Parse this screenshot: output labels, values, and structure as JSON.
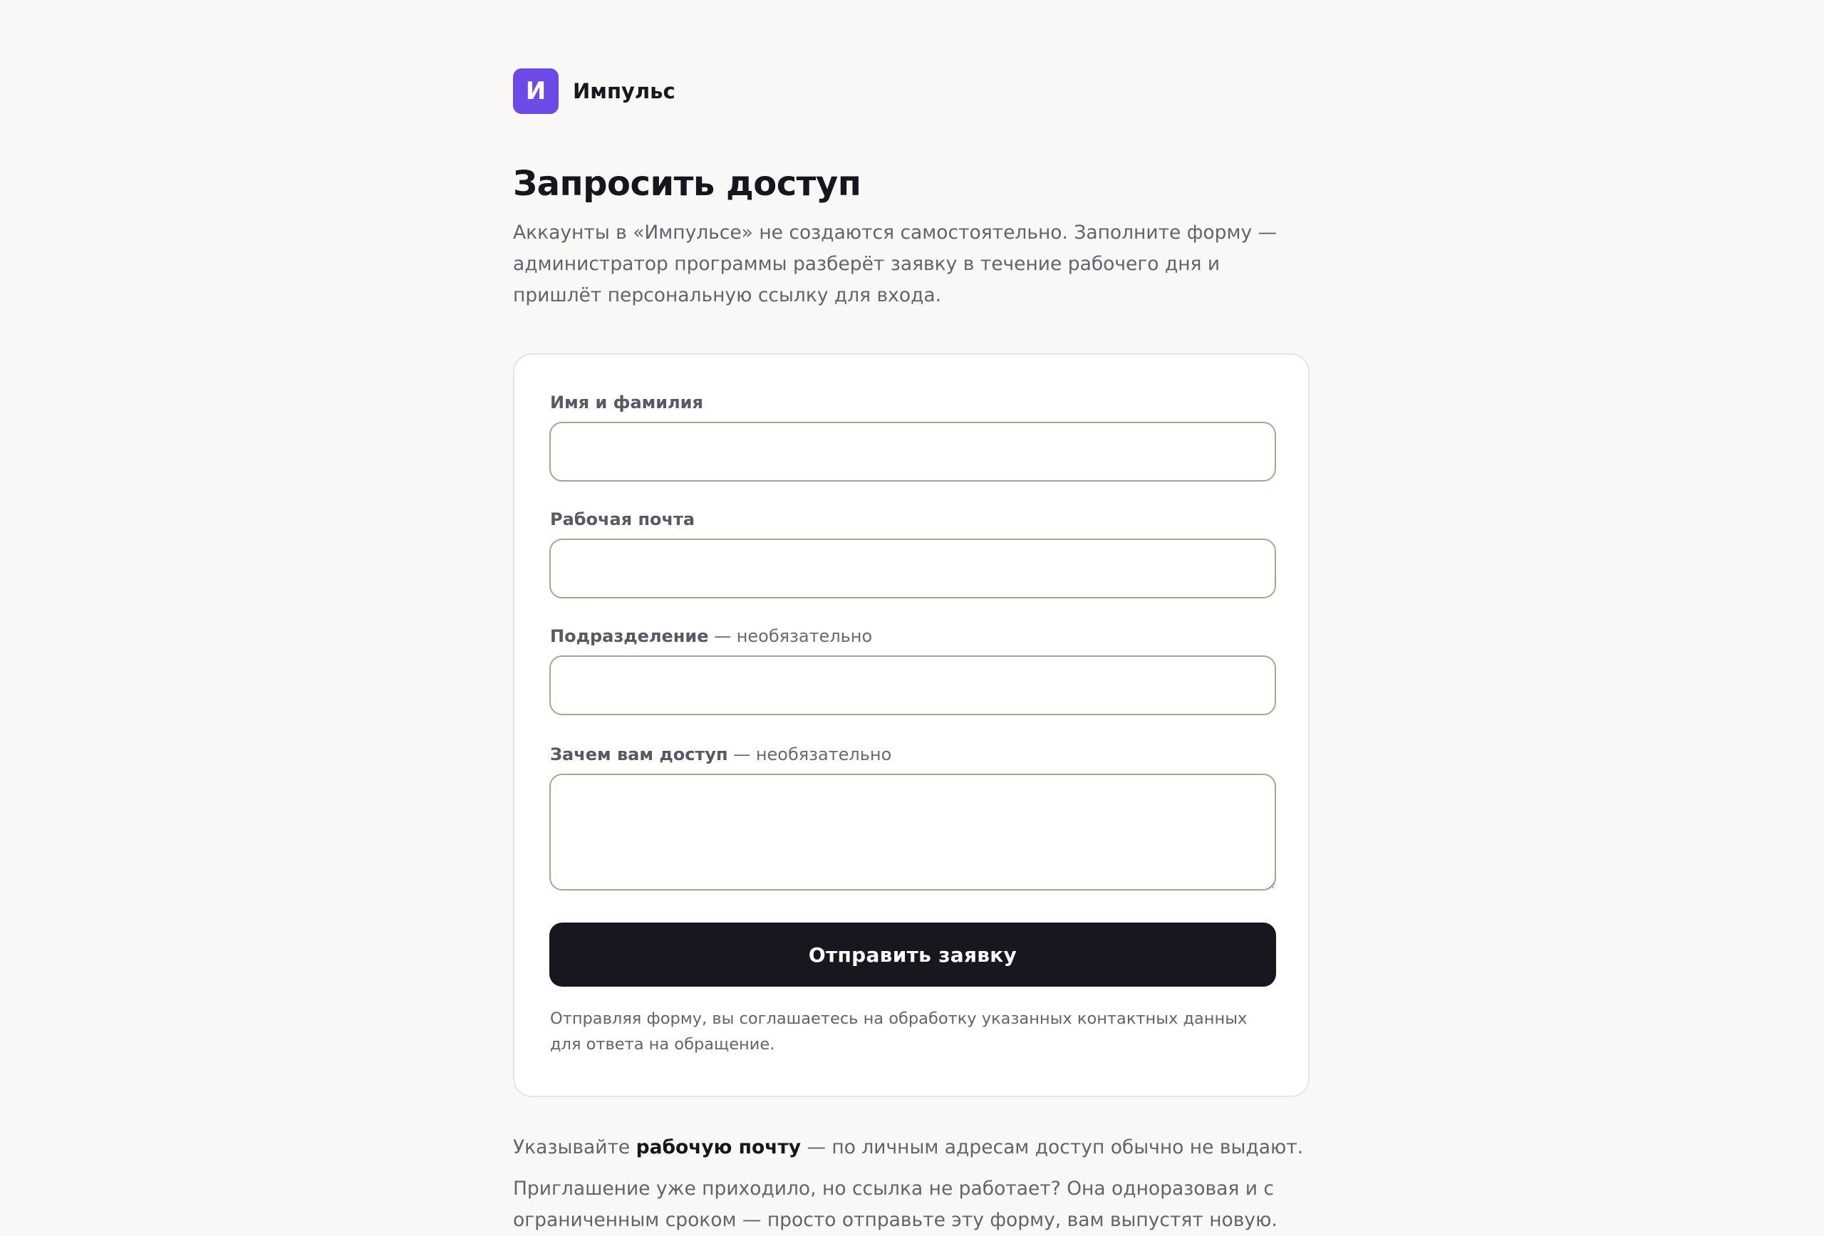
{
  "brand": {
    "mark": "И",
    "name": "Импульс"
  },
  "page": {
    "title": "Запросить доступ",
    "intro": "Аккаунты в «Импульсе» не создаются самостоятельно. Заполните форму — администратор программы разберёт заявку в течение рабочего дня и пришлёт персональную ссылку для входа."
  },
  "form": {
    "fields": [
      {
        "label": "Имя и фамилия",
        "optional": "",
        "value": ""
      },
      {
        "label": "Рабочая почта",
        "optional": "",
        "value": ""
      },
      {
        "label": "Подразделение",
        "optional": " — необязательно",
        "value": ""
      },
      {
        "label": "Зачем вам доступ",
        "optional": " — необязательно",
        "value": ""
      }
    ],
    "submit_label": "Отправить заявку",
    "consent": "Отправляя форму, вы соглашаетесь на обработку указанных контактных данных для ответа на обращение."
  },
  "notes": {
    "work_email_prefix": "Указывайте ",
    "work_email_bold": "рабочую почту",
    "work_email_suffix": " — по личным адресам доступ обычно не выдают.",
    "invite": "Приглашение уже приходило, но ссылка не работает? Она одноразовая и с ограниченным сроком — просто отправьте эту форму, вам выпустят новую."
  },
  "colors": {
    "accent": "#6d4ae8",
    "button": "#181720",
    "background": "#f9f8f6",
    "input_border": "#a9a68e"
  }
}
